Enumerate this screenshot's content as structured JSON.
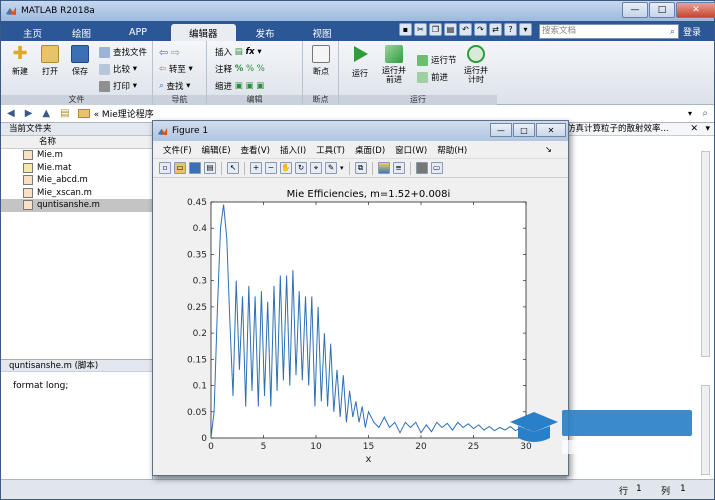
{
  "app": {
    "title": "MATLAB R2018a"
  },
  "window_controls": {
    "minimize": "—",
    "maximize": "□",
    "close": "✕"
  },
  "tabs": [
    {
      "label": "主页",
      "active": false
    },
    {
      "label": "绘图",
      "active": false
    },
    {
      "label": "APP",
      "active": false
    },
    {
      "label": "编辑器",
      "active": true
    },
    {
      "label": "发布",
      "active": false
    },
    {
      "label": "视图",
      "active": false
    }
  ],
  "search": {
    "placeholder": "搜索文档"
  },
  "login_label": "登录",
  "ribbon": {
    "file_group": {
      "label": "文件",
      "new": "新建",
      "open": "打开",
      "save": "保存",
      "find_files": "查找文件",
      "compare": "比较",
      "print": "打印"
    },
    "nav_group": {
      "label": "导航",
      "goto": "转至",
      "find": "查找"
    },
    "edit_group": {
      "label": "编辑",
      "insert": "插入",
      "comment": "注释",
      "indent": "缩进",
      "fx": "fx"
    },
    "breakpoint_group": {
      "label": "断点",
      "breakpoint": "断点"
    },
    "run_group": {
      "label": "运行",
      "run": "运行",
      "run_advance": "运行并\n前进",
      "run_section": "运行节",
      "advance": "前进",
      "run_time": "运行并\n计时"
    }
  },
  "address": {
    "path": "« Mie理论程序"
  },
  "current_folder": {
    "header": "当前文件夹",
    "column": "名称",
    "files": [
      {
        "name": "Mie.m",
        "selected": false
      },
      {
        "name": "Mie.mat",
        "selected": false
      },
      {
        "name": "Mie_abcd.m",
        "selected": false
      },
      {
        "name": "Mie_xscan.m",
        "selected": false
      },
      {
        "name": "quntisanshe.m",
        "selected": true
      }
    ]
  },
  "details": {
    "header": "quntisanshe.m  (脚本)",
    "content": "format long;"
  },
  "editor_right": {
    "title": "仿真计算粒子的散射效率..."
  },
  "status": {
    "row_label": "行",
    "row_value": "1",
    "col_label": "列",
    "col_value": "1"
  },
  "figure": {
    "title": "Figure 1",
    "menu": [
      "文件(F)",
      "编辑(E)",
      "查看(V)",
      "插入(I)",
      "工具(T)",
      "桌面(D)",
      "窗口(W)",
      "帮助(H)"
    ]
  },
  "chart_data": {
    "type": "line",
    "title": "Mie Efficiencies, m=1.52+0.008i",
    "xlabel": "x",
    "ylabel": "",
    "xlim": [
      0,
      30
    ],
    "ylim": [
      0,
      0.45
    ],
    "xticks": [
      0,
      5,
      10,
      15,
      20,
      25,
      30
    ],
    "yticks": [
      0,
      0.05,
      0.1,
      0.15,
      0.2,
      0.25,
      0.3,
      0.35,
      0.4,
      0.45
    ],
    "line_color": "#2f6fb5",
    "series": [
      {
        "x": [
          0,
          0.3,
          0.6,
          0.9,
          1.2,
          1.5,
          1.8,
          2.1,
          2.4,
          2.7,
          3.0,
          3.3,
          3.6,
          3.9,
          4.2,
          4.5,
          4.8,
          5.1,
          5.4,
          5.7,
          6.0,
          6.3,
          6.6,
          6.9,
          7.2,
          7.5,
          7.8,
          8.1,
          8.4,
          8.7,
          9.0,
          9.3,
          9.6,
          9.9,
          10.2,
          10.5,
          10.8,
          11.1,
          11.4,
          11.7,
          12.0,
          12.3,
          12.6,
          12.9,
          13.2,
          13.5,
          13.8,
          14.1,
          14.4,
          14.7,
          15.0,
          15.5,
          16.0,
          16.5,
          17.0,
          17.5,
          18.0,
          18.5,
          19.0,
          19.5,
          20.0,
          20.5,
          21.0,
          21.5,
          22.0,
          22.5,
          23.0,
          23.5,
          24.0,
          24.5,
          25.0,
          25.5,
          26.0,
          26.5,
          27.0,
          27.5,
          28.0,
          28.5,
          29.0,
          29.5,
          30.0
        ],
        "y": [
          0.0,
          0.05,
          0.24,
          0.4,
          0.445,
          0.38,
          0.22,
          0.08,
          0.3,
          0.13,
          0.27,
          0.06,
          0.29,
          0.09,
          0.27,
          0.06,
          0.28,
          0.08,
          0.26,
          0.06,
          0.29,
          0.09,
          0.31,
          0.11,
          0.31,
          0.1,
          0.32,
          0.12,
          0.28,
          0.11,
          0.27,
          0.1,
          0.27,
          0.06,
          0.25,
          0.07,
          0.2,
          0.06,
          0.18,
          0.05,
          0.13,
          0.04,
          0.12,
          0.03,
          0.09,
          0.04,
          0.07,
          0.03,
          0.06,
          0.02,
          0.05,
          0.03,
          0.02,
          0.04,
          0.02,
          0.03,
          0.01,
          0.03,
          0.02,
          0.03,
          0.01,
          0.025,
          0.012,
          0.03,
          0.02,
          0.028,
          0.015,
          0.03,
          0.02,
          0.027,
          0.018,
          0.025,
          0.015,
          0.022,
          0.014,
          0.02,
          0.015,
          0.022,
          0.014,
          0.02,
          0.016
        ]
      }
    ],
    "grid": false
  },
  "colors": {
    "tab_bar": "#2b5797",
    "ribbon": "#e6e9ef",
    "plot_line": "#2f6fb5"
  }
}
